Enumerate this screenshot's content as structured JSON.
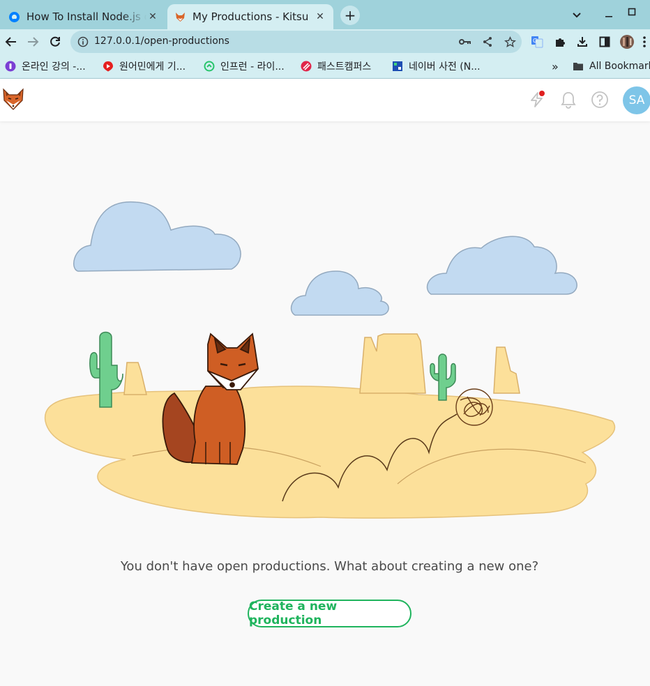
{
  "browser": {
    "tabs": [
      {
        "title": "How To Install Node.js on",
        "icon": "digitalocean-icon",
        "active": false
      },
      {
        "title": "My Productions - Kitsu",
        "icon": "kitsu-fox-icon",
        "active": true
      }
    ],
    "new_tab_label": "+",
    "address": {
      "url": "127.0.0.1/open-productions"
    },
    "bookmarks": [
      {
        "label": "온라인 강의 -...",
        "icon": "purple-circle-icon"
      },
      {
        "label": "원어민에게 기...",
        "icon": "youtube-icon"
      },
      {
        "label": "인프런 - 라이...",
        "icon": "inflearn-icon"
      },
      {
        "label": "패스트캠퍼스",
        "icon": "fastcampus-icon"
      },
      {
        "label": "네이버 사전 (N...",
        "icon": "naver-icon"
      }
    ],
    "overflow_label": "»",
    "all_bookmarks_label": "All Bookmarks"
  },
  "app": {
    "user_initials": "SA",
    "empty_message": "You don't have open productions. What about creating a new one?",
    "create_button_label": "Create a new production",
    "colors": {
      "accent": "#1fb45d",
      "avatar": "#7ec5e8",
      "notification_dot": "#e02020"
    }
  }
}
